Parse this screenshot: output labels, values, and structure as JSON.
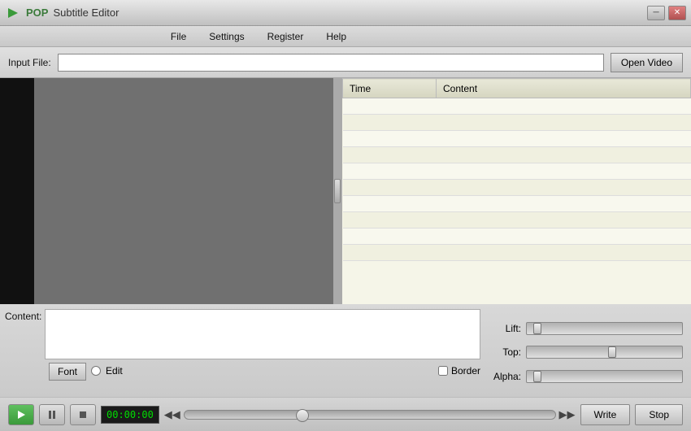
{
  "app": {
    "title_pop": "POP",
    "title_text": "Subtitle Editor",
    "icon": "▶"
  },
  "title_bar": {
    "minimize_label": "─",
    "close_label": "✕"
  },
  "menu": {
    "items": [
      "File",
      "Settings",
      "Register",
      "Help"
    ]
  },
  "input_row": {
    "label": "Input File:",
    "placeholder": "",
    "open_btn": "Open Video"
  },
  "subtitle_table": {
    "headers": [
      "Time",
      "Content"
    ],
    "rows": []
  },
  "content_section": {
    "label": "Content:",
    "font_btn": "Font",
    "edit_label": "Edit",
    "border_label": "Border"
  },
  "sliders": {
    "lift_label": "Lift:",
    "top_label": "Top:",
    "alpha_label": "Alpha:"
  },
  "transport": {
    "time": "00:00:00",
    "play_icon": "▶",
    "pause_icon": "⏸",
    "stop_icon": "■",
    "prev_icon": "◀◀",
    "next_icon": "▶▶",
    "write_btn": "Write",
    "stop_btn": "Stop"
  }
}
